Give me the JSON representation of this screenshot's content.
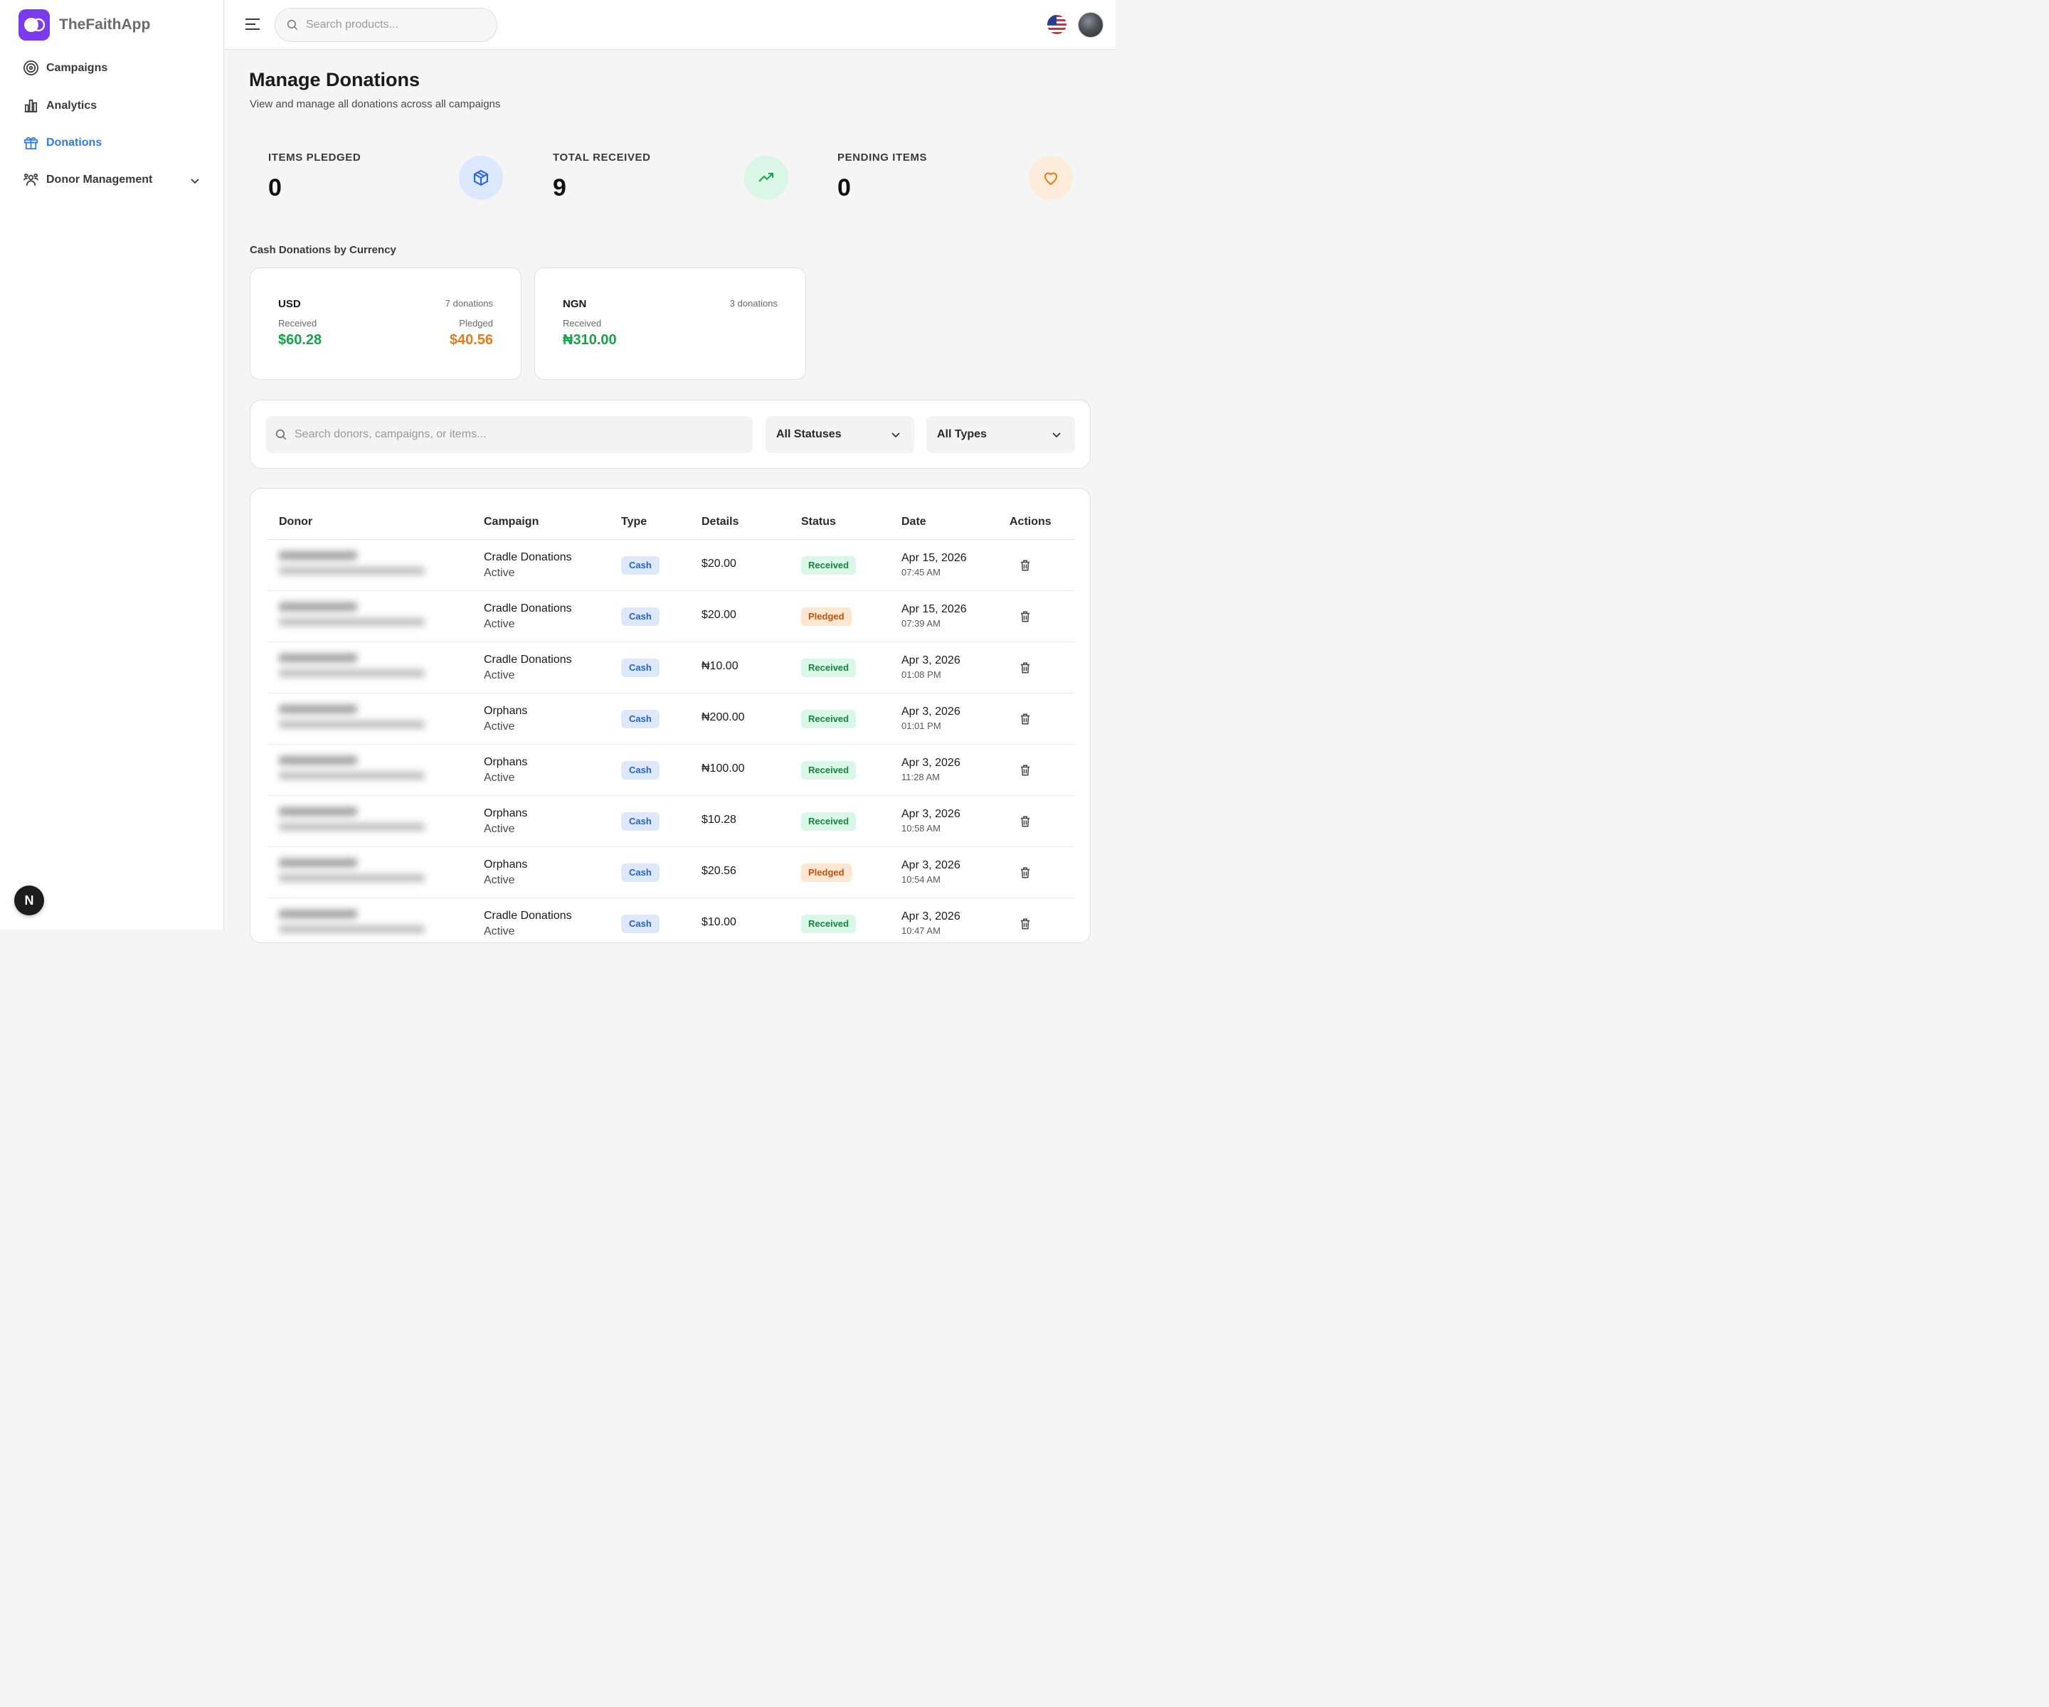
{
  "app": {
    "name": "TheFaithApp"
  },
  "sidebar": {
    "items": [
      {
        "label": "Campaigns",
        "icon": "target-icon"
      },
      {
        "label": "Analytics",
        "icon": "bar-chart-icon"
      },
      {
        "label": "Donations",
        "icon": "gift-icon",
        "active": true
      },
      {
        "label": "Donor Management",
        "icon": "users-icon",
        "expandable": true
      }
    ],
    "badge": "N"
  },
  "header": {
    "search_placeholder": "Search products..."
  },
  "page": {
    "title": "Manage Donations",
    "subtitle": "View and manage all donations across all campaigns"
  },
  "stats": [
    {
      "label": "ITEMS PLEDGED",
      "value": "0",
      "icon": "box-icon",
      "color": "#2563eb"
    },
    {
      "label": "TOTAL RECEIVED",
      "value": "9",
      "icon": "trending-up-icon",
      "color": "#16a34a"
    },
    {
      "label": "PENDING ITEMS",
      "value": "0",
      "icon": "heart-icon",
      "color": "#ea7a16"
    }
  ],
  "currency_section": {
    "label": "Cash Donations by Currency",
    "cards": [
      {
        "code": "USD",
        "count": "7 donations",
        "received_label": "Received",
        "received": "$60.28",
        "pledged_label": "Pledged",
        "pledged": "$40.56"
      },
      {
        "code": "NGN",
        "count": "3 donations",
        "received_label": "Received",
        "received": "₦310.00"
      }
    ]
  },
  "filters": {
    "search_placeholder": "Search donors, campaigns, or items...",
    "status_select": "All Statuses",
    "type_select": "All Types"
  },
  "table": {
    "columns": [
      "Donor",
      "Campaign",
      "Type",
      "Details",
      "Status",
      "Date",
      "Actions"
    ],
    "rows": [
      {
        "campaign": "Cradle Donations",
        "campaign_status": "Active",
        "type": "Cash",
        "details": "$20.00",
        "status": "Received",
        "date": "Apr 15, 2026",
        "time": "07:45 AM"
      },
      {
        "campaign": "Cradle Donations",
        "campaign_status": "Active",
        "type": "Cash",
        "details": "$20.00",
        "status": "Pledged",
        "date": "Apr 15, 2026",
        "time": "07:39 AM"
      },
      {
        "campaign": "Cradle Donations",
        "campaign_status": "Active",
        "type": "Cash",
        "details": "₦10.00",
        "status": "Received",
        "date": "Apr 3, 2026",
        "time": "01:08 PM"
      },
      {
        "campaign": "Orphans",
        "campaign_status": "Active",
        "type": "Cash",
        "details": "₦200.00",
        "status": "Received",
        "date": "Apr 3, 2026",
        "time": "01:01 PM"
      },
      {
        "campaign": "Orphans",
        "campaign_status": "Active",
        "type": "Cash",
        "details": "₦100.00",
        "status": "Received",
        "date": "Apr 3, 2026",
        "time": "11:28 AM"
      },
      {
        "campaign": "Orphans",
        "campaign_status": "Active",
        "type": "Cash",
        "details": "$10.28",
        "status": "Received",
        "date": "Apr 3, 2026",
        "time": "10:58 AM"
      },
      {
        "campaign": "Orphans",
        "campaign_status": "Active",
        "type": "Cash",
        "details": "$20.56",
        "status": "Pledged",
        "date": "Apr 3, 2026",
        "time": "10:54 AM"
      },
      {
        "campaign": "Cradle Donations",
        "campaign_status": "Active",
        "type": "Cash",
        "details": "$10.00",
        "status": "Received",
        "date": "Apr 3, 2026",
        "time": "10:47 AM"
      }
    ]
  }
}
